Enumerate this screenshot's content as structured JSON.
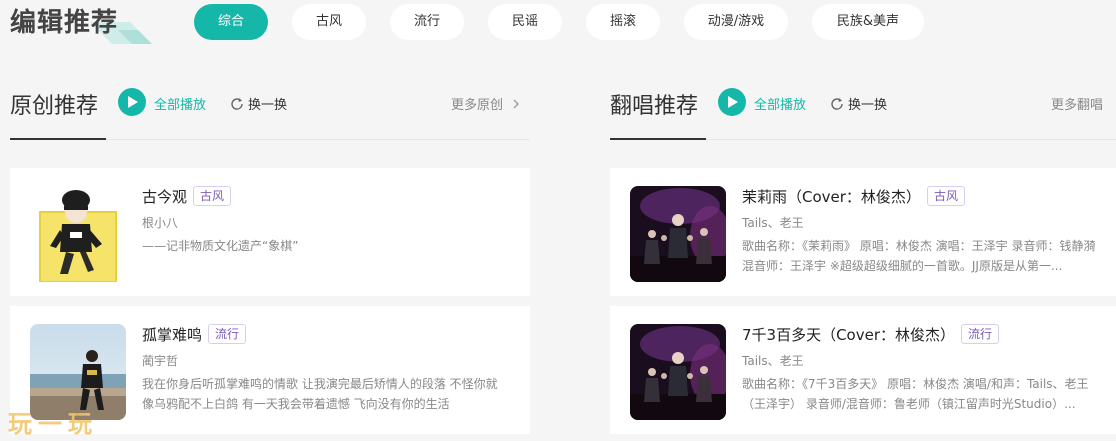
{
  "header": {
    "title": "编辑推荐"
  },
  "categories": [
    "综合",
    "古风",
    "流行",
    "民谣",
    "摇滚",
    "动漫/游戏",
    "民族&美声"
  ],
  "original": {
    "title": "原创推荐",
    "play_all": "全部播放",
    "refresh": "换一换",
    "more": "更多原创",
    "songs": [
      {
        "title": "古今观",
        "tag": "古风",
        "artist": "根小八",
        "desc": "——记非物质文化遗产“象棋”"
      },
      {
        "title": "孤掌难鸣",
        "tag": "流行",
        "artist": "蔺宇哲",
        "desc": "我在你身后听孤掌难鸣的情歌 让我演完最后矫情人的段落 不怪你就像乌鸦配不上白鸽 有一天我会带着遗憾 飞向没有你的生活"
      }
    ]
  },
  "cover": {
    "title": "翻唱推荐",
    "play_all": "全部播放",
    "refresh": "换一换",
    "more": "更多翻唱",
    "songs": [
      {
        "title": "茉莉雨（Cover：林俊杰）",
        "tag": "古风",
        "artist": "Tails、老王",
        "desc": "歌曲名称：《茉莉雨》 原唱：林俊杰 演唱：王泽宇 录音师：钱静漪 混音师：王泽宇 ※超级超级细腻的一首歌。JJ原版是从第一..."
      },
      {
        "title": "7千3百多天（Cover：林俊杰）",
        "tag": "流行",
        "artist": "Tails、老王",
        "desc": "歌曲名称：《7千3百多天》 原唱：林俊杰 演唱/和声：Tails、老王（王泽宇） 录音师/混音师：鲁老师（镇江留声时光Studio）..."
      }
    ]
  },
  "watermark": "玩一玩",
  "colors": {
    "accent": "#15b7a8",
    "tag_text": "#7a5bb8",
    "background": "#f5f5f5"
  }
}
